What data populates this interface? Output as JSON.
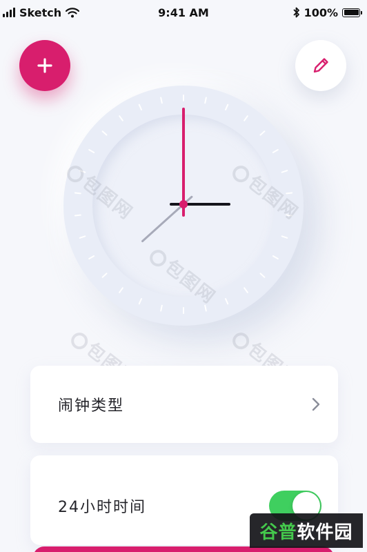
{
  "status_bar": {
    "carrier": "Sketch",
    "time": "9:41 AM",
    "battery": "100%"
  },
  "actions": {
    "add_icon": "plus-icon",
    "edit_icon": "pencil-icon"
  },
  "clock": {
    "hour": 3,
    "minute": 0,
    "second": 38
  },
  "settings": {
    "alarm_type_label": "闹钟类型",
    "format_24h_label": "24小时时间",
    "format_24h_enabled": true
  },
  "watermark": {
    "text": "包图网",
    "badge_part1": "谷普",
    "badge_part2": "软件园"
  },
  "colors": {
    "accent": "#d81e6d",
    "toggle_on": "#3fcf5f",
    "clock_face": "#e9edf7"
  }
}
